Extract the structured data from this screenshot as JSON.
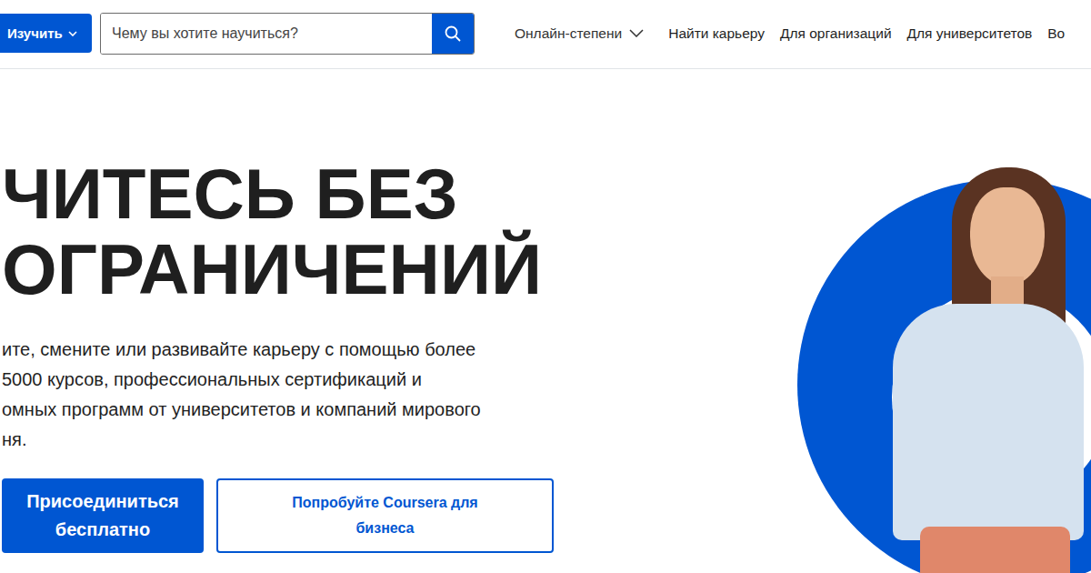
{
  "header": {
    "explore_button": {
      "label": "Изучить"
    },
    "search": {
      "placeholder": "Чему вы хотите научиться?"
    },
    "nav": [
      {
        "label": "Онлайн-степени",
        "has_dropdown": true
      },
      {
        "label": "Найти карьеру",
        "has_dropdown": false
      },
      {
        "label": "Для организаций",
        "has_dropdown": false
      },
      {
        "label": "Для университетов",
        "has_dropdown": false
      },
      {
        "label": "Во",
        "has_dropdown": false
      }
    ]
  },
  "hero": {
    "title_lines": [
      "ЧИТЕСЬ БЕЗ",
      "ОГРАНИЧЕНИЙ"
    ],
    "description_lines": [
      "ите, смените или развивайте карьеру с помощью более",
      "5000 курсов, профессиональных сертификаций и",
      "омных программ от университетов и компаний мирового",
      "ня."
    ],
    "buttons": [
      {
        "label": "Присоединиться бесплатно",
        "kind": "primary"
      },
      {
        "label": "Попробуйте Coursera для бизнеса",
        "kind": "secondary"
      }
    ]
  }
}
